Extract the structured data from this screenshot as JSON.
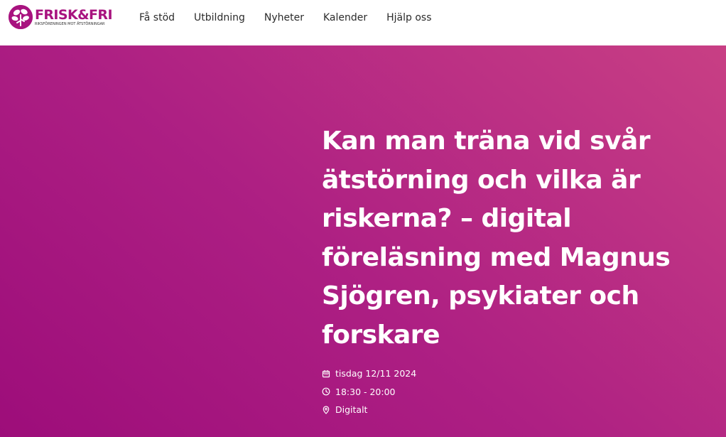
{
  "brand": {
    "name": "FRISK&FRI",
    "tagline": "RIKSFÖRENINGEN MOT ÄTSTÖRNINGAR",
    "color": "#a8137f"
  },
  "nav": {
    "items": [
      {
        "label": "Få stöd"
      },
      {
        "label": "Utbildning"
      },
      {
        "label": "Nyheter"
      },
      {
        "label": "Kalender"
      },
      {
        "label": "Hjälp oss"
      }
    ]
  },
  "event": {
    "title": "Kan man träna vid svår ätstörning och vilka är riskerna? – digital föreläsning med Magnus Sjögren, psykiater och forskare",
    "date": "tisdag 12/11 2024",
    "time": "18:30 - 20:00",
    "location": "Digitalt",
    "icons": {
      "date": "calendar-icon",
      "time": "clock-icon",
      "location": "location-pin-icon"
    }
  },
  "colors": {
    "hero_start": "#9d0d7a",
    "hero_end": "#c83f84",
    "text_on_hero": "#ffffff"
  }
}
